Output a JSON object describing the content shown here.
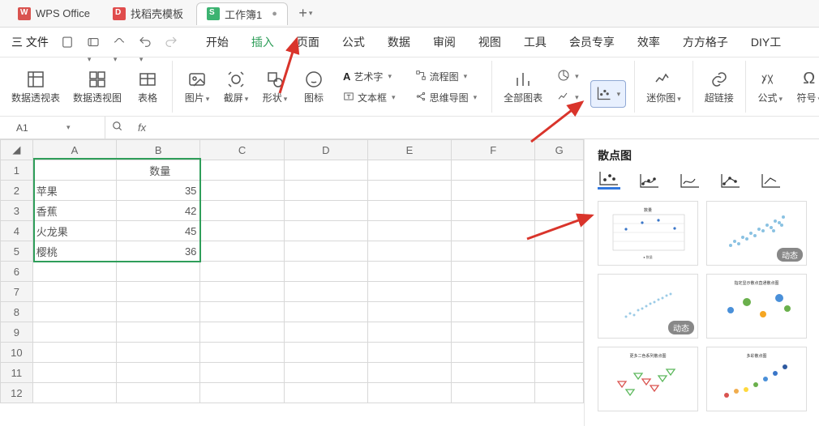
{
  "titlebar": {
    "app_name": "WPS Office",
    "template_tab": "找稻壳模板",
    "workbook_tab": "工作簿1",
    "plus": "+"
  },
  "menubar": {
    "file": "三 文件",
    "tabs": [
      "开始",
      "插入",
      "页面",
      "公式",
      "数据",
      "审阅",
      "视图",
      "工具",
      "会员专享",
      "效率",
      "方方格子",
      "DIY工"
    ],
    "active_index": 1
  },
  "ribbon": {
    "pivot_table": "数据透视表",
    "pivot_chart": "数据透视图",
    "table": "表格",
    "picture": "图片",
    "screenshot": "截屏",
    "shape": "形状",
    "icon": "图标",
    "wordart": "艺术字",
    "textbox": "文本框",
    "flowchart": "流程图",
    "mindmap": "思维导图",
    "all_charts": "全部图表",
    "pie_dd": "",
    "scatter_dd": "",
    "sparkline": "迷你图",
    "hyperlink": "超链接",
    "formula": "公式",
    "symbol": "符号"
  },
  "fbar": {
    "cell_ref": "A1",
    "fx": "fx"
  },
  "columns": [
    "A",
    "B",
    "C",
    "D",
    "E",
    "F",
    "G"
  ],
  "rows": [
    1,
    2,
    3,
    4,
    5,
    6,
    7,
    8,
    9,
    10,
    11,
    12
  ],
  "sheet_data": {
    "B1": "数量",
    "A2": "苹果",
    "B2": "35",
    "A3": "香蕉",
    "B3": "42",
    "A4": "火龙果",
    "B4": "45",
    "A5": "樱桃",
    "B5": "36"
  },
  "panel": {
    "title": "散点图",
    "badge_dynamic": "动态",
    "preview_titles": [
      "数量",
      "",
      "",
      "指定显示散点直通散点图",
      "更多二色系列散点图",
      "多彩散点图"
    ]
  }
}
